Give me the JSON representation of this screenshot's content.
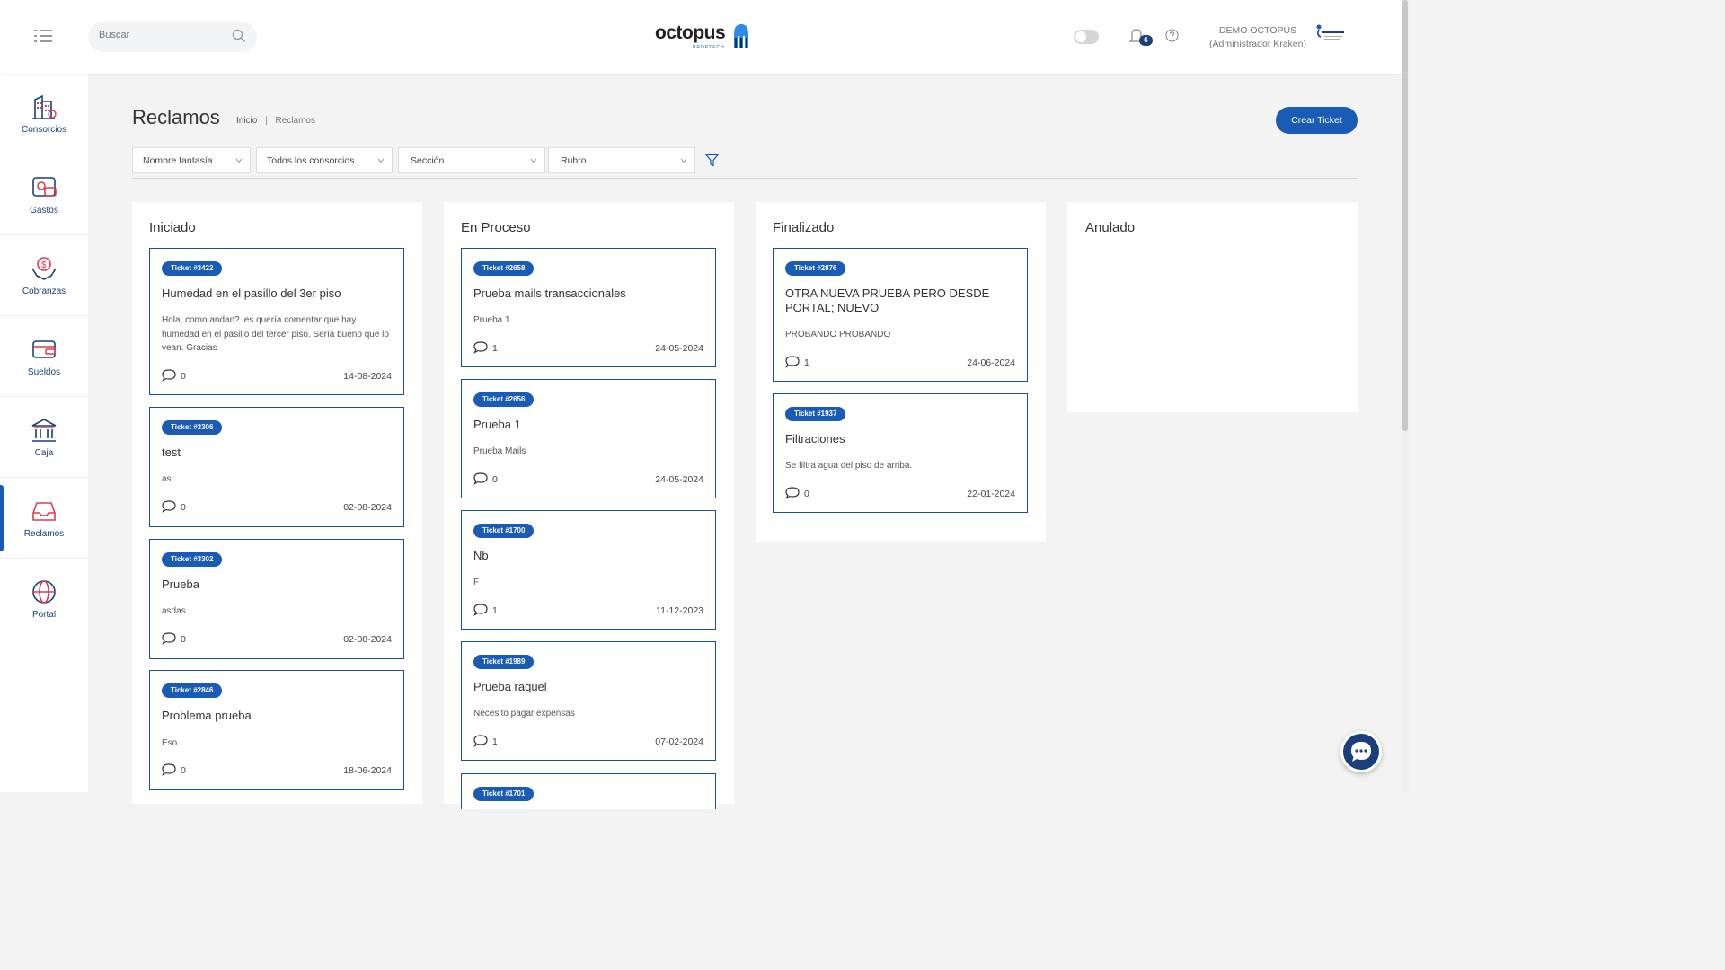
{
  "header": {
    "search_placeholder": "Buscar",
    "logo_text": "octopus",
    "logo_sub": "PROPTECH",
    "notifications_count": "6",
    "user_name": "DEMO OCTOPUS",
    "user_role": "(Administrador Kraken)"
  },
  "sidebar": {
    "items": [
      {
        "label": "Consorcios",
        "icon": "building-icon"
      },
      {
        "label": "Gastos",
        "icon": "expenses-icon"
      },
      {
        "label": "Cobranzas",
        "icon": "collections-icon"
      },
      {
        "label": "Sueldos",
        "icon": "wallet-icon"
      },
      {
        "label": "Caja",
        "icon": "bank-icon"
      },
      {
        "label": "Reclamos",
        "icon": "inbox-icon"
      },
      {
        "label": "Portal",
        "icon": "globe-icon"
      }
    ],
    "active": "Reclamos"
  },
  "page": {
    "title": "Reclamos",
    "breadcrumb_home": "Inicio",
    "breadcrumb_sep": "|",
    "breadcrumb_current": "Reclamos",
    "create_button": "Crear Ticket"
  },
  "filters": {
    "nombre": "Nombre fantasía",
    "consorcios": "Todos los consorcios",
    "seccion": "Sección",
    "rubro": "Rubro"
  },
  "columns": [
    {
      "title": "Iniciado",
      "tickets": [
        {
          "id": "Ticket #3422",
          "title": "Humedad en el pasillo del 3er piso",
          "desc": "Hola, como andan? les quería comentar que hay humedad en el pasillo del tercer piso. Sería bueno que lo vean. Gracias",
          "comments": "0",
          "date": "14-08-2024"
        },
        {
          "id": "Ticket #3306",
          "title": "test",
          "desc": "as",
          "comments": "0",
          "date": "02-08-2024"
        },
        {
          "id": "Ticket #3302",
          "title": "Prueba",
          "desc": "asdas",
          "comments": "0",
          "date": "02-08-2024"
        },
        {
          "id": "Ticket #2846",
          "title": "Problema prueba",
          "desc": "Eso",
          "comments": "0",
          "date": "18-06-2024"
        }
      ]
    },
    {
      "title": "En Proceso",
      "tickets": [
        {
          "id": "Ticket #2658",
          "title": "Prueba mails transaccionales",
          "desc": "Prueba 1",
          "comments": "1",
          "date": "24-05-2024"
        },
        {
          "id": "Ticket #2656",
          "title": "Prueba 1",
          "desc": "Prueba Mails",
          "comments": "0",
          "date": "24-05-2024"
        },
        {
          "id": "Ticket #1700",
          "title": "Nb",
          "desc": "F",
          "comments": "1",
          "date": "11-12-2023"
        },
        {
          "id": "Ticket #1989",
          "title": "Prueba raquel",
          "desc": "Necesito pagar expensas",
          "comments": "1",
          "date": "07-02-2024"
        },
        {
          "id": "Ticket #1701",
          "title": "",
          "desc": "",
          "comments": "",
          "date": ""
        }
      ]
    },
    {
      "title": "Finalizado",
      "tickets": [
        {
          "id": "Ticket #2876",
          "title": "OTRA NUEVA PRUEBA PERO DESDE PORTAL; NUEVO",
          "desc": "PROBANDO PROBANDO",
          "comments": "1",
          "date": "24-06-2024"
        },
        {
          "id": "Ticket #1937",
          "title": "Filtraciones",
          "desc": "Se filtra agua del piso de arriba.",
          "comments": "0",
          "date": "22-01-2024"
        }
      ]
    },
    {
      "title": "Anulado",
      "tickets": []
    }
  ],
  "colors": {
    "primary": "#1a5cb5",
    "dark_blue": "#1a3f7a",
    "accent_red": "#e03a4e"
  }
}
